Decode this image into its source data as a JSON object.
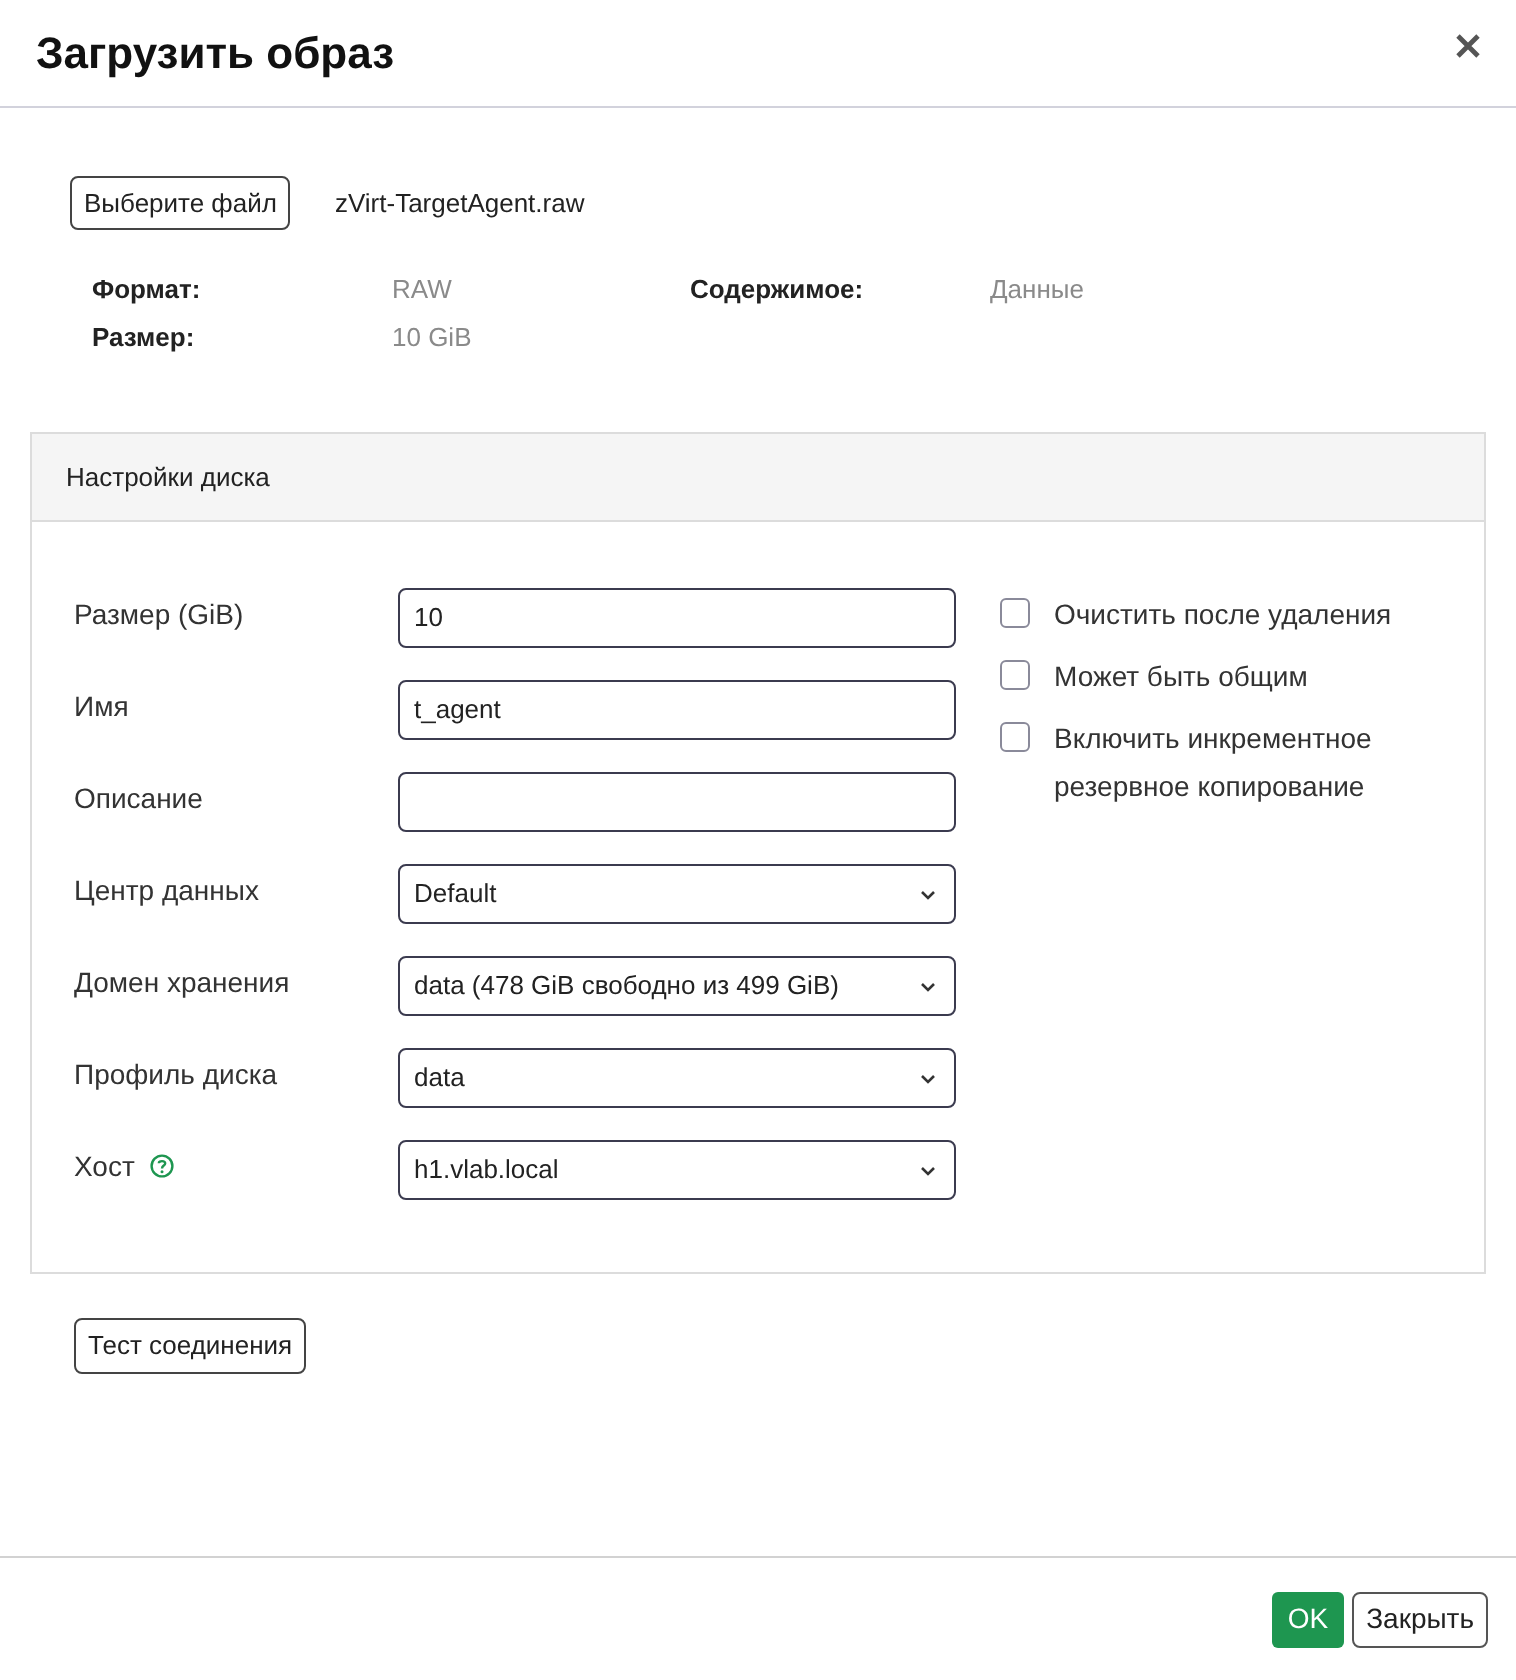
{
  "dialog": {
    "title": "Загрузить образ"
  },
  "file": {
    "button": "Выберите файл",
    "name": "zVirt-TargetAgent.raw"
  },
  "info": [
    {
      "label": "Формат:",
      "value": "RAW"
    },
    {
      "label": "Содержимое:",
      "value": "Данные"
    },
    {
      "label": "Размер:",
      "value": "10 GiB"
    }
  ],
  "disk_settings": {
    "title": "Настройки диска",
    "fields": [
      {
        "kind": "input",
        "label": "Размер (GiB)",
        "value": "10"
      },
      {
        "kind": "input",
        "label": "Имя",
        "value": "t_agent"
      },
      {
        "kind": "input",
        "label": "Описание"
      },
      {
        "kind": "select",
        "label": "Центр данных",
        "value": "Default"
      },
      {
        "kind": "select",
        "label": "Домен хранения",
        "value": "data (478 GiB свободно из 499 GiB)"
      },
      {
        "kind": "select",
        "label": "Профиль диска",
        "value": "data"
      },
      {
        "kind": "select",
        "label": "Хост",
        "value": "h1.vlab.local",
        "help": true
      }
    ],
    "checkboxes": [
      {
        "label": "Очистить после удаления",
        "checked": false
      },
      {
        "label": "Может быть общим",
        "checked": false
      },
      {
        "label": "Включить инкрементное резервное копирование",
        "checked": false
      }
    ]
  },
  "test_button": "Тест соединения",
  "footer": {
    "buttons": [
      {
        "label": "OK",
        "kind": "primary"
      },
      {
        "label": "Закрыть",
        "kind": "secondary"
      }
    ]
  }
}
